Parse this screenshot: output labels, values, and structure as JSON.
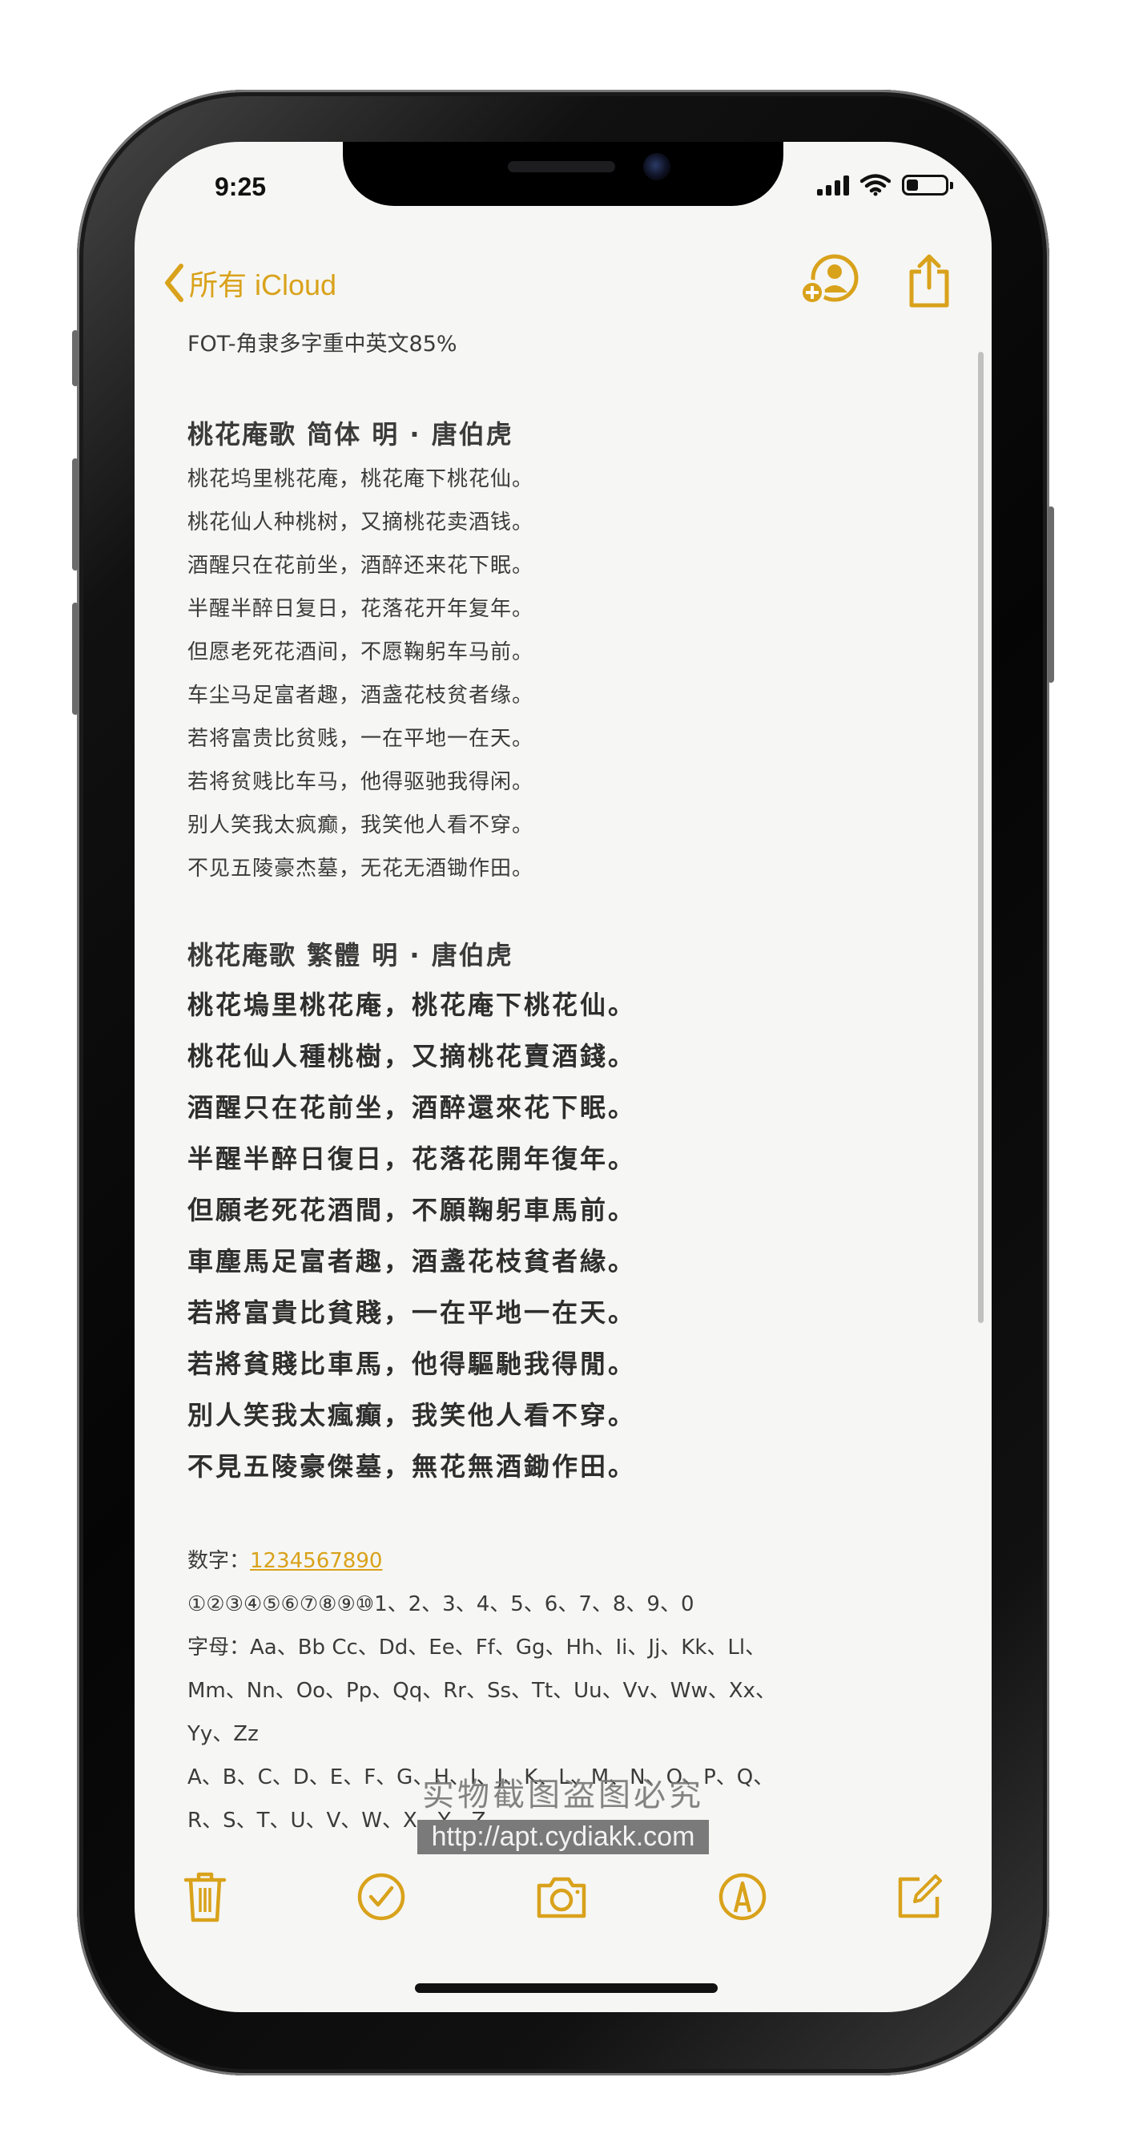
{
  "status": {
    "time": "9:25"
  },
  "nav": {
    "back_label": "所有 iCloud"
  },
  "note": {
    "meta": "FOT-角隶多字重中英文85%",
    "simplified": {
      "title": "桃花庵歌 简体  明 · 唐伯虎",
      "lines": [
        "桃花坞里桃花庵，桃花庵下桃花仙。",
        "桃花仙人种桃树，又摘桃花卖酒钱。",
        "酒醒只在花前坐，酒醉还来花下眠。",
        "半醒半醉日复日，花落花开年复年。",
        "但愿老死花酒间，不愿鞠躬车马前。",
        "车尘马足富者趣，酒盏花枝贫者缘。",
        "若将富贵比贫贱，一在平地一在天。",
        "若将贫贱比车马，他得驱驰我得闲。",
        "别人笑我太疯癫，我笑他人看不穿。",
        "不见五陵豪杰墓，无花无酒锄作田。"
      ]
    },
    "traditional": {
      "title": "桃花庵歌 繁體   明 · 唐伯虎",
      "lines": [
        "桃花塢里桃花庵，桃花庵下桃花仙。",
        "桃花仙人種桃樹，又摘桃花賣酒錢。",
        "酒醒只在花前坐，酒醉還來花下眠。",
        "半醒半醉日復日，花落花開年復年。",
        "但願老死花酒間，不願鞠躬車馬前。",
        "車塵馬足富者趣，酒盞花枝貧者緣。",
        "若將富貴比貧賤，一在平地一在天。",
        "若將貧賤比車馬，他得驅馳我得閒。",
        "別人笑我太瘋癲，我笑他人看不穿。",
        "不見五陵豪傑墓，無花無酒鋤作田。"
      ]
    },
    "digits_label": "数字：",
    "digits_link": "1234567890",
    "circled": "①②③④⑤⑥⑦⑧⑨⑩1、2、3、4、5、6、7、8、9、0",
    "letters_1": "字母：Aa、Bb Cc、Dd、Ee、Ff、Gg、Hh、Ii、Jj、Kk、Ll、",
    "letters_2": "Mm、Nn、Oo、Pp、Qq、Rr、Ss、Tt、Uu、Vv、Ww、Xx、",
    "letters_3": "Yy、Zz",
    "letters_4": "A、B、C、D、E、F、G、H、I、J、K、L、M、N、O、P、Q、",
    "letters_5": "R、S、T、U、V、W、X、Y、Z"
  },
  "watermark": {
    "line1": "实物截图盗图必究",
    "line2": "http://apt.cydiakk.com"
  },
  "colors": {
    "accent": "#d9a21b"
  },
  "toolbar_icons": [
    "trash-icon",
    "checklist-icon",
    "camera-icon",
    "markup-icon",
    "compose-icon"
  ]
}
